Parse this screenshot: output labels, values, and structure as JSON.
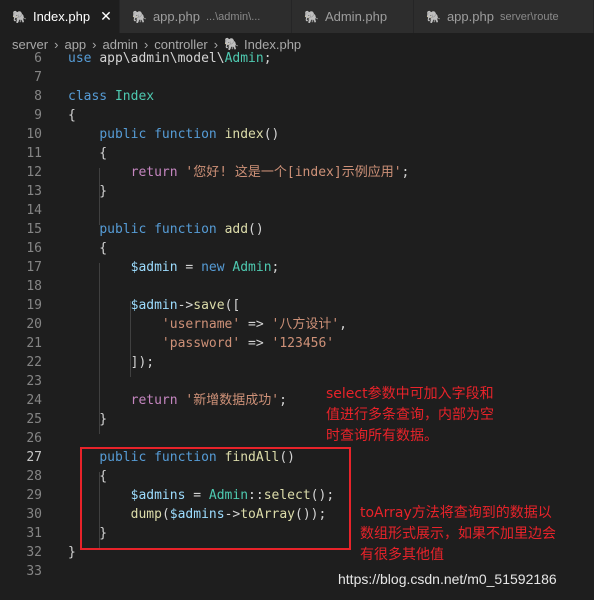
{
  "tabs": [
    {
      "name": "Index.php",
      "hint": "",
      "active": true,
      "closable": true
    },
    {
      "name": "app.php",
      "hint": "...\\admin\\...",
      "active": false
    },
    {
      "name": "Admin.php",
      "hint": "",
      "active": false
    },
    {
      "name": "app.php",
      "hint": "server\\route",
      "active": false
    }
  ],
  "breadcrumb": [
    "server",
    "app",
    "admin",
    "controller",
    "Index.php"
  ],
  "code_lines": [
    {
      "n": "6",
      "text": "use app\\admin\\model\\Admin;"
    },
    {
      "n": "7",
      "text": ""
    },
    {
      "n": "8",
      "text": "class Index"
    },
    {
      "n": "9",
      "text": "{"
    },
    {
      "n": "10",
      "text": "    public function index()"
    },
    {
      "n": "11",
      "text": "    {"
    },
    {
      "n": "12",
      "text": "        return '您好! 这是一个[index]示例应用';"
    },
    {
      "n": "13",
      "text": "    }"
    },
    {
      "n": "14",
      "text": ""
    },
    {
      "n": "15",
      "text": "    public function add()"
    },
    {
      "n": "16",
      "text": "    {"
    },
    {
      "n": "17",
      "text": "        $admin = new Admin;"
    },
    {
      "n": "18",
      "text": ""
    },
    {
      "n": "19",
      "text": "        $admin->save(["
    },
    {
      "n": "20",
      "text": "            'username' => '八方设计',"
    },
    {
      "n": "21",
      "text": "            'password' => '123456'"
    },
    {
      "n": "22",
      "text": "        ]);"
    },
    {
      "n": "23",
      "text": ""
    },
    {
      "n": "24",
      "text": "        return '新增数据成功';"
    },
    {
      "n": "25",
      "text": "    }"
    },
    {
      "n": "26",
      "text": ""
    },
    {
      "n": "27",
      "text": "    public function findAll()"
    },
    {
      "n": "28",
      "text": "    {"
    },
    {
      "n": "29",
      "text": "        $admins = Admin::select();"
    },
    {
      "n": "30",
      "text": "        dump($admins->toArray());"
    },
    {
      "n": "31",
      "text": "    }"
    },
    {
      "n": "32",
      "text": "}"
    },
    {
      "n": "33",
      "text": ""
    }
  ],
  "current_line": "27",
  "annotations": {
    "note1": [
      "select参数中可加入字段和",
      "值进行多条查询，内部为空",
      "时查询所有数据。"
    ],
    "note2": [
      "toArray方法将查询到的数据以",
      "数组形式展示，如果不加里边会",
      "有很多其他值"
    ],
    "watermark": "https://blog.csdn.net/m0_51592186"
  },
  "colors": {
    "annotation": "#e8232a",
    "keyword": "#569cd6",
    "string": "#ce9178",
    "class": "#4ec9b0",
    "function": "#dcdcaa",
    "variable": "#9cdcfe"
  }
}
